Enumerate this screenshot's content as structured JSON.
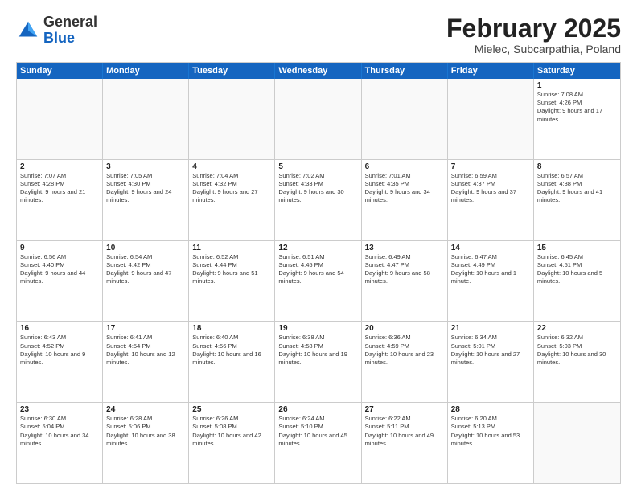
{
  "header": {
    "logo": {
      "general": "General",
      "blue": "Blue"
    },
    "title": "February 2025",
    "location": "Mielec, Subcarpathia, Poland"
  },
  "weekdays": [
    "Sunday",
    "Monday",
    "Tuesday",
    "Wednesday",
    "Thursday",
    "Friday",
    "Saturday"
  ],
  "rows": [
    [
      {
        "day": "",
        "info": "",
        "empty": true
      },
      {
        "day": "",
        "info": "",
        "empty": true
      },
      {
        "day": "",
        "info": "",
        "empty": true
      },
      {
        "day": "",
        "info": "",
        "empty": true
      },
      {
        "day": "",
        "info": "",
        "empty": true
      },
      {
        "day": "",
        "info": "",
        "empty": true
      },
      {
        "day": "1",
        "info": "Sunrise: 7:08 AM\nSunset: 4:26 PM\nDaylight: 9 hours and 17 minutes.",
        "empty": false
      }
    ],
    [
      {
        "day": "2",
        "info": "Sunrise: 7:07 AM\nSunset: 4:28 PM\nDaylight: 9 hours and 21 minutes.",
        "empty": false
      },
      {
        "day": "3",
        "info": "Sunrise: 7:05 AM\nSunset: 4:30 PM\nDaylight: 9 hours and 24 minutes.",
        "empty": false
      },
      {
        "day": "4",
        "info": "Sunrise: 7:04 AM\nSunset: 4:32 PM\nDaylight: 9 hours and 27 minutes.",
        "empty": false
      },
      {
        "day": "5",
        "info": "Sunrise: 7:02 AM\nSunset: 4:33 PM\nDaylight: 9 hours and 30 minutes.",
        "empty": false
      },
      {
        "day": "6",
        "info": "Sunrise: 7:01 AM\nSunset: 4:35 PM\nDaylight: 9 hours and 34 minutes.",
        "empty": false
      },
      {
        "day": "7",
        "info": "Sunrise: 6:59 AM\nSunset: 4:37 PM\nDaylight: 9 hours and 37 minutes.",
        "empty": false
      },
      {
        "day": "8",
        "info": "Sunrise: 6:57 AM\nSunset: 4:38 PM\nDaylight: 9 hours and 41 minutes.",
        "empty": false
      }
    ],
    [
      {
        "day": "9",
        "info": "Sunrise: 6:56 AM\nSunset: 4:40 PM\nDaylight: 9 hours and 44 minutes.",
        "empty": false
      },
      {
        "day": "10",
        "info": "Sunrise: 6:54 AM\nSunset: 4:42 PM\nDaylight: 9 hours and 47 minutes.",
        "empty": false
      },
      {
        "day": "11",
        "info": "Sunrise: 6:52 AM\nSunset: 4:44 PM\nDaylight: 9 hours and 51 minutes.",
        "empty": false
      },
      {
        "day": "12",
        "info": "Sunrise: 6:51 AM\nSunset: 4:45 PM\nDaylight: 9 hours and 54 minutes.",
        "empty": false
      },
      {
        "day": "13",
        "info": "Sunrise: 6:49 AM\nSunset: 4:47 PM\nDaylight: 9 hours and 58 minutes.",
        "empty": false
      },
      {
        "day": "14",
        "info": "Sunrise: 6:47 AM\nSunset: 4:49 PM\nDaylight: 10 hours and 1 minute.",
        "empty": false
      },
      {
        "day": "15",
        "info": "Sunrise: 6:45 AM\nSunset: 4:51 PM\nDaylight: 10 hours and 5 minutes.",
        "empty": false
      }
    ],
    [
      {
        "day": "16",
        "info": "Sunrise: 6:43 AM\nSunset: 4:52 PM\nDaylight: 10 hours and 9 minutes.",
        "empty": false
      },
      {
        "day": "17",
        "info": "Sunrise: 6:41 AM\nSunset: 4:54 PM\nDaylight: 10 hours and 12 minutes.",
        "empty": false
      },
      {
        "day": "18",
        "info": "Sunrise: 6:40 AM\nSunset: 4:56 PM\nDaylight: 10 hours and 16 minutes.",
        "empty": false
      },
      {
        "day": "19",
        "info": "Sunrise: 6:38 AM\nSunset: 4:58 PM\nDaylight: 10 hours and 19 minutes.",
        "empty": false
      },
      {
        "day": "20",
        "info": "Sunrise: 6:36 AM\nSunset: 4:59 PM\nDaylight: 10 hours and 23 minutes.",
        "empty": false
      },
      {
        "day": "21",
        "info": "Sunrise: 6:34 AM\nSunset: 5:01 PM\nDaylight: 10 hours and 27 minutes.",
        "empty": false
      },
      {
        "day": "22",
        "info": "Sunrise: 6:32 AM\nSunset: 5:03 PM\nDaylight: 10 hours and 30 minutes.",
        "empty": false
      }
    ],
    [
      {
        "day": "23",
        "info": "Sunrise: 6:30 AM\nSunset: 5:04 PM\nDaylight: 10 hours and 34 minutes.",
        "empty": false
      },
      {
        "day": "24",
        "info": "Sunrise: 6:28 AM\nSunset: 5:06 PM\nDaylight: 10 hours and 38 minutes.",
        "empty": false
      },
      {
        "day": "25",
        "info": "Sunrise: 6:26 AM\nSunset: 5:08 PM\nDaylight: 10 hours and 42 minutes.",
        "empty": false
      },
      {
        "day": "26",
        "info": "Sunrise: 6:24 AM\nSunset: 5:10 PM\nDaylight: 10 hours and 45 minutes.",
        "empty": false
      },
      {
        "day": "27",
        "info": "Sunrise: 6:22 AM\nSunset: 5:11 PM\nDaylight: 10 hours and 49 minutes.",
        "empty": false
      },
      {
        "day": "28",
        "info": "Sunrise: 6:20 AM\nSunset: 5:13 PM\nDaylight: 10 hours and 53 minutes.",
        "empty": false
      },
      {
        "day": "",
        "info": "",
        "empty": true
      }
    ]
  ]
}
